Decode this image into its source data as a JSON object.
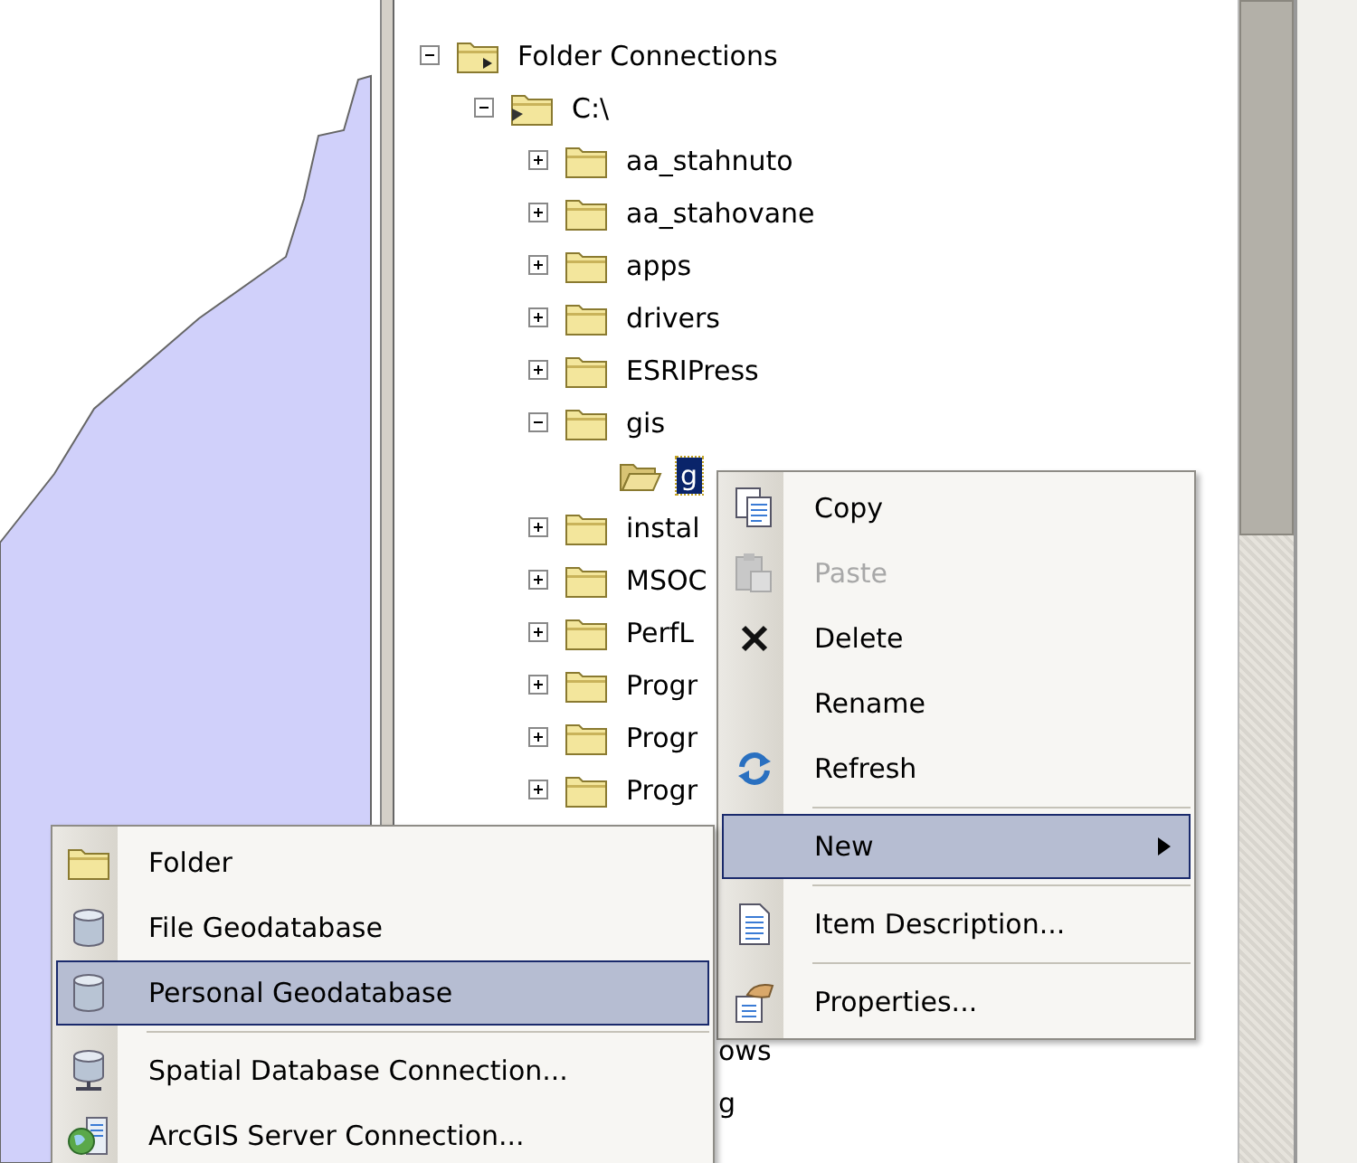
{
  "tree": [
    {
      "label": "Folder Connections",
      "kind": "connection",
      "expanded": true,
      "selected": false,
      "children": [
        {
          "label": "C:\\",
          "kind": "drive",
          "expanded": true,
          "selected": false,
          "children": [
            {
              "label": "aa_stahnuto",
              "kind": "folder",
              "expanded": false,
              "selected": false
            },
            {
              "label": "aa_stahovane",
              "kind": "folder",
              "expanded": false,
              "selected": false
            },
            {
              "label": "apps",
              "kind": "folder",
              "expanded": false,
              "selected": false
            },
            {
              "label": "drivers",
              "kind": "folder",
              "expanded": false,
              "selected": false
            },
            {
              "label": "ESRIPress",
              "kind": "folder",
              "expanded": false,
              "selected": false
            },
            {
              "label": "gis",
              "kind": "folder",
              "expanded": true,
              "selected": false,
              "children": [
                {
                  "label": "g",
                  "kind": "open",
                  "selected": true
                }
              ]
            },
            {
              "label": "instal",
              "kind": "folder",
              "expanded": false,
              "selected": false
            },
            {
              "label": "MSOC",
              "kind": "folder",
              "expanded": false,
              "selected": false
            },
            {
              "label": "PerfL",
              "kind": "folder",
              "expanded": false,
              "selected": false
            },
            {
              "label": "Progr",
              "kind": "folder",
              "expanded": false,
              "selected": false
            },
            {
              "label": "Progr",
              "kind": "folder",
              "expanded": false,
              "selected": false
            },
            {
              "label": "Progr",
              "kind": "folder",
              "expanded": false,
              "selected": false
            }
          ]
        }
      ]
    }
  ],
  "tree_tail": [
    "ows",
    "g"
  ],
  "context_menu": [
    {
      "label": "Copy",
      "kind": "copy",
      "disabled": false,
      "selected": false
    },
    {
      "label": "Paste",
      "kind": "paste",
      "disabled": true,
      "selected": false
    },
    {
      "label": "Delete",
      "kind": "delete",
      "disabled": false,
      "selected": false
    },
    {
      "label": "Rename",
      "kind": "plain",
      "disabled": false,
      "selected": false
    },
    {
      "label": "Refresh",
      "kind": "refresh",
      "disabled": false,
      "selected": false
    },
    {
      "kind": "separator"
    },
    {
      "label": "New",
      "kind": "submenu",
      "disabled": false,
      "selected": true
    },
    {
      "kind": "separator"
    },
    {
      "label": "Item Description...",
      "kind": "description",
      "disabled": false,
      "selected": false
    },
    {
      "kind": "separator"
    },
    {
      "label": "Properties...",
      "kind": "properties",
      "disabled": false,
      "selected": false
    }
  ],
  "submenu": [
    {
      "label": "Folder",
      "kind": "folder",
      "disabled": false,
      "selected": false
    },
    {
      "label": "File Geodatabase",
      "kind": "geodatabase",
      "disabled": false,
      "selected": false
    },
    {
      "label": "Personal Geodatabase",
      "kind": "geodatabase",
      "disabled": false,
      "selected": true
    },
    {
      "kind": "separator"
    },
    {
      "label": "Spatial Database Connection...",
      "kind": "connection",
      "disabled": false,
      "selected": false
    },
    {
      "label": "ArcGIS Server Connection...",
      "kind": "server",
      "disabled": false,
      "selected": false
    }
  ]
}
